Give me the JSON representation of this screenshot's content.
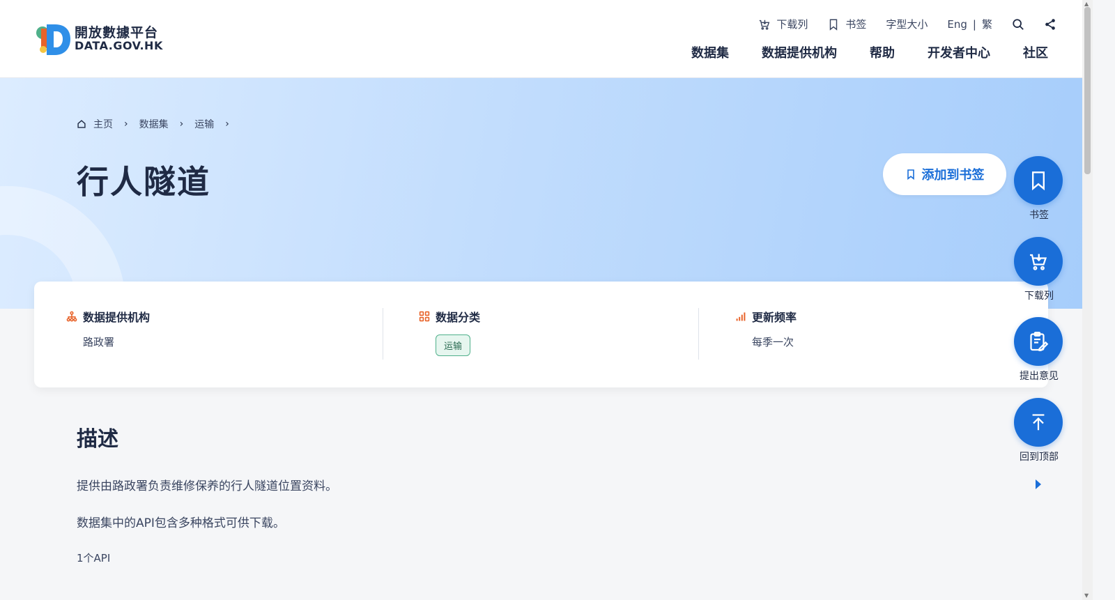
{
  "brand": {
    "name_zh": "開放數據平台",
    "name_en": "DATA.GOV.HK"
  },
  "header": {
    "utility": {
      "download_list": "下载列",
      "bookmark": "书签",
      "font_size": "字型大小",
      "lang_en": "Eng",
      "lang_sep": "|",
      "lang_tc": "繁"
    },
    "nav": [
      "数据集",
      "数据提供机构",
      "帮助",
      "开发者中心",
      "社区"
    ]
  },
  "breadcrumb": {
    "home": "主页",
    "items": [
      "数据集",
      "运输"
    ]
  },
  "page": {
    "title": "行人隧道",
    "add_bookmark": "添加到书签"
  },
  "info": {
    "provider_title": "数据提供机构",
    "provider_value": "路政署",
    "category_title": "数据分类",
    "category_tag": "运输",
    "frequency_title": "更新频率",
    "frequency_value": "每季一次"
  },
  "description": {
    "title": "描述",
    "p1": "提供由路政署负责维修保养的行人隧道位置资料。",
    "p2": "数据集中的API包含多种格式可供下载。",
    "p3": "1个API"
  },
  "floating": {
    "bookmark": "书签",
    "download_list": "下载列",
    "feedback": "提出意见",
    "back_to_top": "回到顶部"
  },
  "colors": {
    "primary": "#1a6ed8",
    "accent_orange": "#e8632a",
    "tag_green": "#4fb08a",
    "text_dark": "#1f2a44"
  }
}
